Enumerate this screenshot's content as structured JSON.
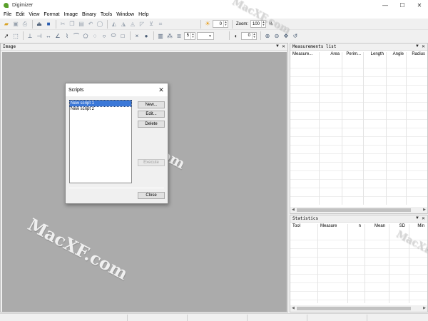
{
  "window": {
    "title": "Digimizer",
    "controls": {
      "minimize": "—",
      "maximize": "☐",
      "close": "✕"
    }
  },
  "menu": [
    "File",
    "Edit",
    "View",
    "Format",
    "Image",
    "Binary",
    "Tools",
    "Window",
    "Help"
  ],
  "toolbar": {
    "brightness_value": "0",
    "contrast_value": "0",
    "zoom_label": "Zoom:",
    "zoom_value": "100",
    "zoom_unit": "%",
    "line_width_value": "5"
  },
  "image_panel": {
    "title": "Image",
    "pin": "▼",
    "close": "✕"
  },
  "measurements_panel": {
    "title": "Measurements list",
    "pin": "▼",
    "close": "✕",
    "columns": [
      "Measure...",
      "Area",
      "Perim...",
      "Length",
      "Angle",
      "Radius"
    ]
  },
  "statistics_panel": {
    "title": "Statistics",
    "pin": "▼",
    "close": "✕",
    "columns": [
      "Tool",
      "Measure",
      "n",
      "Mean",
      "SD",
      "Min"
    ]
  },
  "dialog": {
    "title": "Scripts",
    "close": "✕",
    "scripts": [
      "New script 1",
      "New script 2"
    ],
    "selected_index": 0,
    "buttons": {
      "new": "New...",
      "edit": "Edit...",
      "delete": "Delete",
      "execute": "Execute",
      "close": "Close"
    }
  },
  "watermarks": [
    "MacXF.com",
    "MacXF.com",
    "MacXF.com",
    "MacXF.com"
  ]
}
